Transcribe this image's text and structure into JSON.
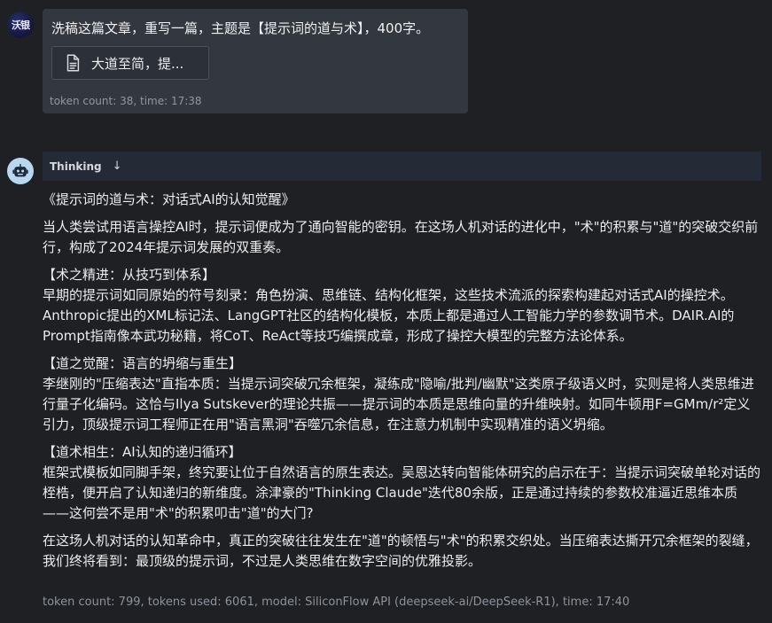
{
  "user": {
    "avatar_text": "沃银",
    "prompt": "洗稿这篇文章，重写一篇，主题是【提示词的道与术】，400字。",
    "attachment_name": "大道至简，提...",
    "meta": "token count: 38, time: 17:38"
  },
  "assistant": {
    "thinking_label": "Thinking",
    "thinking_toggle": "↓",
    "title": "《提示词的道与术：对话式AI的认知觉醒》",
    "intro": "当人类尝试用语言操控AI时，提示词便成为了通向智能的密钥。在这场人机对话的进化中，\"术\"的积累与\"道\"的突破交织前行，构成了2024年提示词发展的双重奏。",
    "section1_heading": "【术之精进：从技巧到体系】",
    "section1_body": "早期的提示词如同原始的符号刻录：角色扮演、思维链、结构化框架，这些技术流派的探索构建起对话式AI的操控术。Anthropic提出的XML标记法、LangGPT社区的结构化模板，本质上都是通过人工智能力学的参数调节术。DAIR.AI的Prompt指南像本武功秘籍，将CoT、ReAct等技巧编撰成章，形成了操控大模型的完整方法论体系。",
    "section2_heading": "【道之觉醒：语言的坍缩与重生】",
    "section2_body": "李继刚的\"压缩表达\"直指本质：当提示词突破冗余框架，凝练成\"隐喻/批判/幽默\"这类原子级语义时，实则是将人类思维进行量子化编码。这恰与Ilya Sutskever的理论共振——提示词的本质是思维向量的升维映射。如同牛顿用F=GMm/r²定义引力，顶级提示词工程师正在用\"语言黑洞\"吞噬冗余信息，在注意力机制中实现精准的语义坍缩。",
    "section3_heading": "【道术相生：AI认知的递归循环】",
    "section3_body": "框架式模板如同脚手架，终究要让位于自然语言的原生表达。吴恩达转向智能体研究的启示在于：当提示词突破单轮对话的桎梏，便开启了认知递归的新维度。涂津豪的\"Thinking Claude\"迭代80余版，正是通过持续的参数校准逼近思维本质——这何尝不是用\"术\"的积累叩击\"道\"的大门?",
    "conclusion": "在这场人机对话的认知革命中，真正的突破往往发生在\"道\"的顿悟与\"术\"的积累交织处。当压缩表达撕开冗余框架的裂缝，我们终将看到：最顶级的提示词，不过是人类思维在数字空间的优雅投影。",
    "meta": "token count: 799, tokens used: 6061, model: SiliconFlow API (deepseek-ai/DeepSeek-R1), time: 17:40"
  },
  "colors": {
    "background": "#1f2023",
    "user_bubble": "#33373f",
    "thinking_bar": "#252b36",
    "bot_avatar": "#b9d7f0"
  }
}
